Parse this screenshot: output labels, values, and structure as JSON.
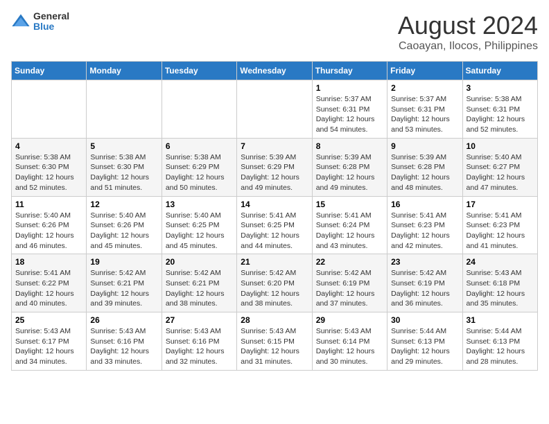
{
  "header": {
    "logo_general": "General",
    "logo_blue": "Blue",
    "title": "August 2024",
    "subtitle": "Caoayan, Ilocos, Philippines"
  },
  "days_of_week": [
    "Sunday",
    "Monday",
    "Tuesday",
    "Wednesday",
    "Thursday",
    "Friday",
    "Saturday"
  ],
  "weeks": [
    [
      {
        "day": "",
        "info": ""
      },
      {
        "day": "",
        "info": ""
      },
      {
        "day": "",
        "info": ""
      },
      {
        "day": "",
        "info": ""
      },
      {
        "day": "1",
        "info": "Sunrise: 5:37 AM\nSunset: 6:31 PM\nDaylight: 12 hours and 54 minutes."
      },
      {
        "day": "2",
        "info": "Sunrise: 5:37 AM\nSunset: 6:31 PM\nDaylight: 12 hours and 53 minutes."
      },
      {
        "day": "3",
        "info": "Sunrise: 5:38 AM\nSunset: 6:31 PM\nDaylight: 12 hours and 52 minutes."
      }
    ],
    [
      {
        "day": "4",
        "info": "Sunrise: 5:38 AM\nSunset: 6:30 PM\nDaylight: 12 hours and 52 minutes."
      },
      {
        "day": "5",
        "info": "Sunrise: 5:38 AM\nSunset: 6:30 PM\nDaylight: 12 hours and 51 minutes."
      },
      {
        "day": "6",
        "info": "Sunrise: 5:38 AM\nSunset: 6:29 PM\nDaylight: 12 hours and 50 minutes."
      },
      {
        "day": "7",
        "info": "Sunrise: 5:39 AM\nSunset: 6:29 PM\nDaylight: 12 hours and 49 minutes."
      },
      {
        "day": "8",
        "info": "Sunrise: 5:39 AM\nSunset: 6:28 PM\nDaylight: 12 hours and 49 minutes."
      },
      {
        "day": "9",
        "info": "Sunrise: 5:39 AM\nSunset: 6:28 PM\nDaylight: 12 hours and 48 minutes."
      },
      {
        "day": "10",
        "info": "Sunrise: 5:40 AM\nSunset: 6:27 PM\nDaylight: 12 hours and 47 minutes."
      }
    ],
    [
      {
        "day": "11",
        "info": "Sunrise: 5:40 AM\nSunset: 6:26 PM\nDaylight: 12 hours and 46 minutes."
      },
      {
        "day": "12",
        "info": "Sunrise: 5:40 AM\nSunset: 6:26 PM\nDaylight: 12 hours and 45 minutes."
      },
      {
        "day": "13",
        "info": "Sunrise: 5:40 AM\nSunset: 6:25 PM\nDaylight: 12 hours and 45 minutes."
      },
      {
        "day": "14",
        "info": "Sunrise: 5:41 AM\nSunset: 6:25 PM\nDaylight: 12 hours and 44 minutes."
      },
      {
        "day": "15",
        "info": "Sunrise: 5:41 AM\nSunset: 6:24 PM\nDaylight: 12 hours and 43 minutes."
      },
      {
        "day": "16",
        "info": "Sunrise: 5:41 AM\nSunset: 6:23 PM\nDaylight: 12 hours and 42 minutes."
      },
      {
        "day": "17",
        "info": "Sunrise: 5:41 AM\nSunset: 6:23 PM\nDaylight: 12 hours and 41 minutes."
      }
    ],
    [
      {
        "day": "18",
        "info": "Sunrise: 5:41 AM\nSunset: 6:22 PM\nDaylight: 12 hours and 40 minutes."
      },
      {
        "day": "19",
        "info": "Sunrise: 5:42 AM\nSunset: 6:21 PM\nDaylight: 12 hours and 39 minutes."
      },
      {
        "day": "20",
        "info": "Sunrise: 5:42 AM\nSunset: 6:21 PM\nDaylight: 12 hours and 38 minutes."
      },
      {
        "day": "21",
        "info": "Sunrise: 5:42 AM\nSunset: 6:20 PM\nDaylight: 12 hours and 38 minutes."
      },
      {
        "day": "22",
        "info": "Sunrise: 5:42 AM\nSunset: 6:19 PM\nDaylight: 12 hours and 37 minutes."
      },
      {
        "day": "23",
        "info": "Sunrise: 5:42 AM\nSunset: 6:19 PM\nDaylight: 12 hours and 36 minutes."
      },
      {
        "day": "24",
        "info": "Sunrise: 5:43 AM\nSunset: 6:18 PM\nDaylight: 12 hours and 35 minutes."
      }
    ],
    [
      {
        "day": "25",
        "info": "Sunrise: 5:43 AM\nSunset: 6:17 PM\nDaylight: 12 hours and 34 minutes."
      },
      {
        "day": "26",
        "info": "Sunrise: 5:43 AM\nSunset: 6:16 PM\nDaylight: 12 hours and 33 minutes."
      },
      {
        "day": "27",
        "info": "Sunrise: 5:43 AM\nSunset: 6:16 PM\nDaylight: 12 hours and 32 minutes."
      },
      {
        "day": "28",
        "info": "Sunrise: 5:43 AM\nSunset: 6:15 PM\nDaylight: 12 hours and 31 minutes."
      },
      {
        "day": "29",
        "info": "Sunrise: 5:43 AM\nSunset: 6:14 PM\nDaylight: 12 hours and 30 minutes."
      },
      {
        "day": "30",
        "info": "Sunrise: 5:44 AM\nSunset: 6:13 PM\nDaylight: 12 hours and 29 minutes."
      },
      {
        "day": "31",
        "info": "Sunrise: 5:44 AM\nSunset: 6:13 PM\nDaylight: 12 hours and 28 minutes."
      }
    ]
  ]
}
